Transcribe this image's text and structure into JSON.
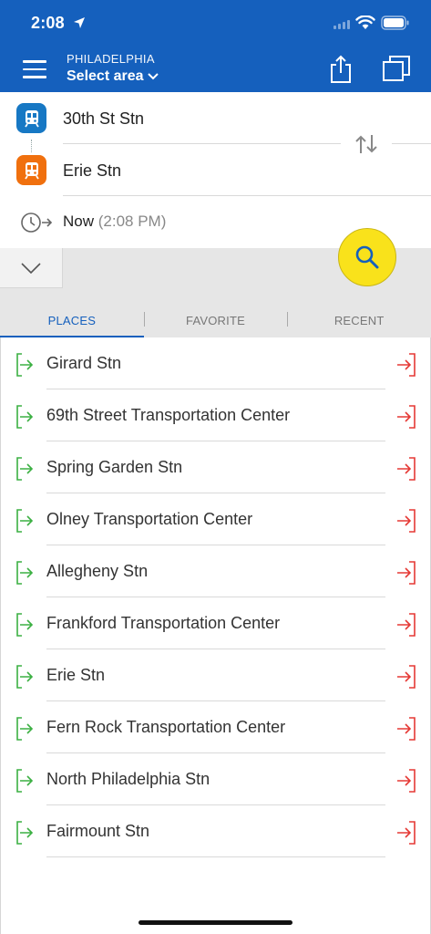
{
  "status": {
    "time": "2:08"
  },
  "header": {
    "city": "PHILADELPHIA",
    "area_label": "Select area"
  },
  "route": {
    "from": "30th St Stn",
    "to": "Erie Stn",
    "time_now": "Now",
    "time_clock": "(2:08 PM)"
  },
  "tabs": [
    {
      "label": "PLACES",
      "active": true
    },
    {
      "label": "FAVORITE",
      "active": false
    },
    {
      "label": "RECENT",
      "active": false
    }
  ],
  "places": [
    "Girard Stn",
    "69th Street Transportation Center",
    "Spring Garden Stn",
    "Olney Transportation Center",
    "Allegheny Stn",
    "Frankford Transportation Center",
    "Erie Stn",
    "Fern Rock Transportation Center",
    "North Philadelphia Stn",
    "Fairmount Stn"
  ],
  "colors": {
    "header_bg": "#1560BD",
    "from_icon": "#1778C4",
    "to_icon": "#F0700E",
    "search_button": "#F9E21B",
    "set_origin_icon": "#3CB043",
    "set_destination_icon": "#E53935"
  },
  "icons": {
    "menu": "hamburger-icon",
    "share": "share-icon",
    "copy": "copy-icon",
    "swap": "swap-icon",
    "clock": "clock-icon",
    "search": "search-icon",
    "expand": "chevron-down-icon",
    "from": "train-icon",
    "to": "train-icon",
    "set_origin": "enter-icon",
    "set_destination": "exit-icon"
  }
}
